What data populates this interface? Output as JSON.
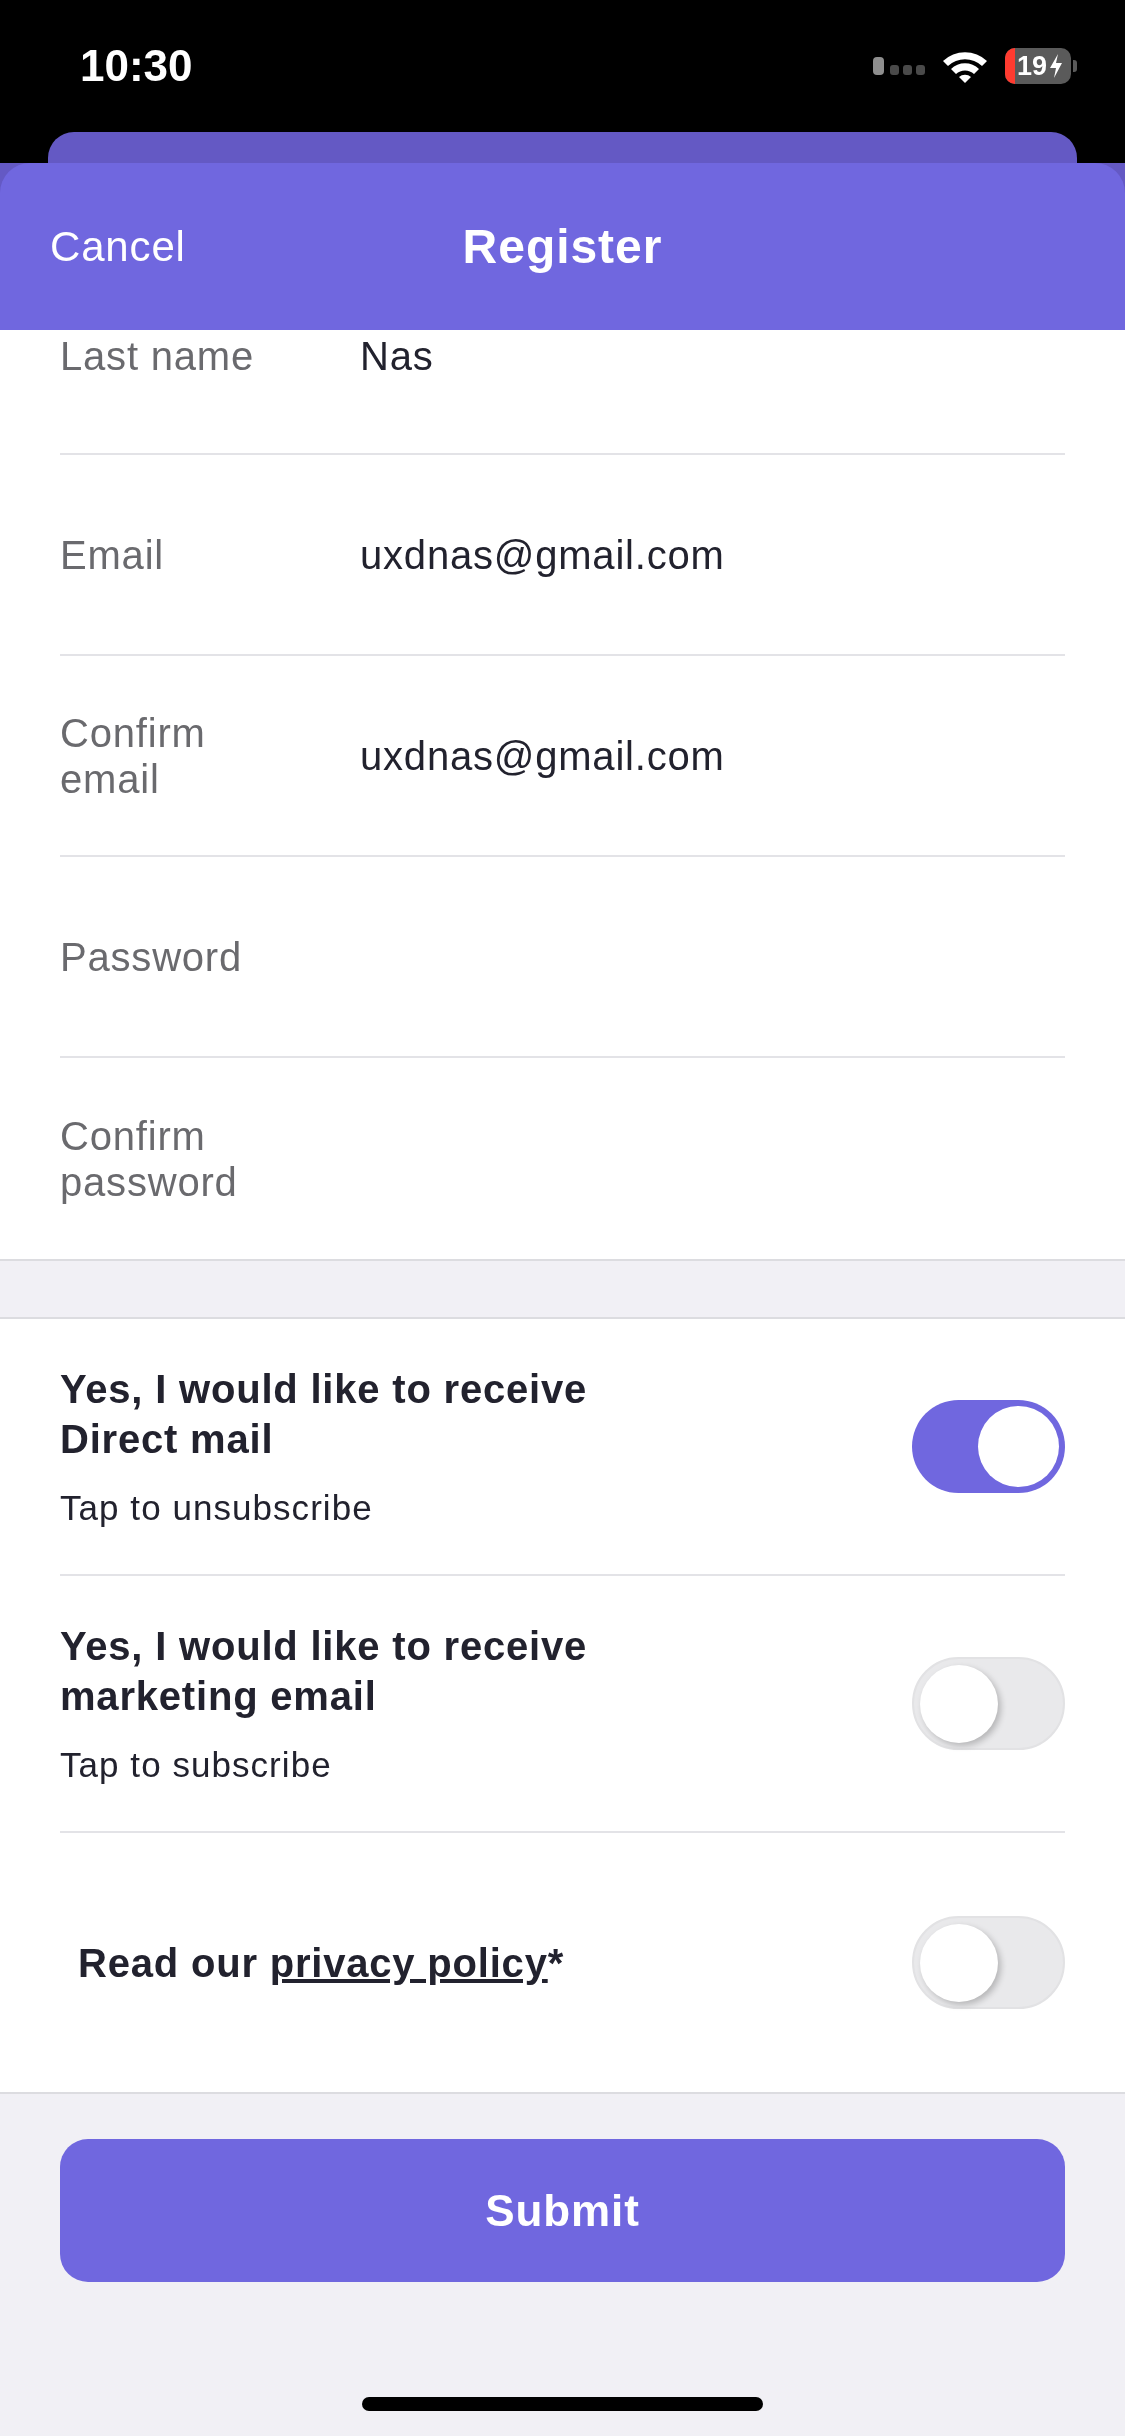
{
  "status_bar": {
    "time": "10:30",
    "battery": "19"
  },
  "header": {
    "cancel": "Cancel",
    "title": "Register"
  },
  "fields": [
    {
      "label": "Last name",
      "value": "Nas"
    },
    {
      "label": "Email",
      "value": "uxdnas@gmail.com"
    },
    {
      "label": "Confirm email",
      "value": "uxdnas@gmail.com"
    },
    {
      "label": "Password"
    },
    {
      "label": "Confirm password"
    }
  ],
  "preferences": [
    {
      "kind": "subscription",
      "title": "Yes, I would like to receive Direct mail",
      "subtitle": "Tap to unsubscribe",
      "on": true
    },
    {
      "kind": "subscription",
      "title": "Yes, I would like to receive marketing email",
      "subtitle": "Tap to subscribe",
      "on": false
    },
    {
      "kind": "policy",
      "text_before": "Read our",
      "link": "privacy policy",
      "text_after": "*",
      "on": false
    }
  ],
  "submit": {
    "label": "Submit"
  }
}
